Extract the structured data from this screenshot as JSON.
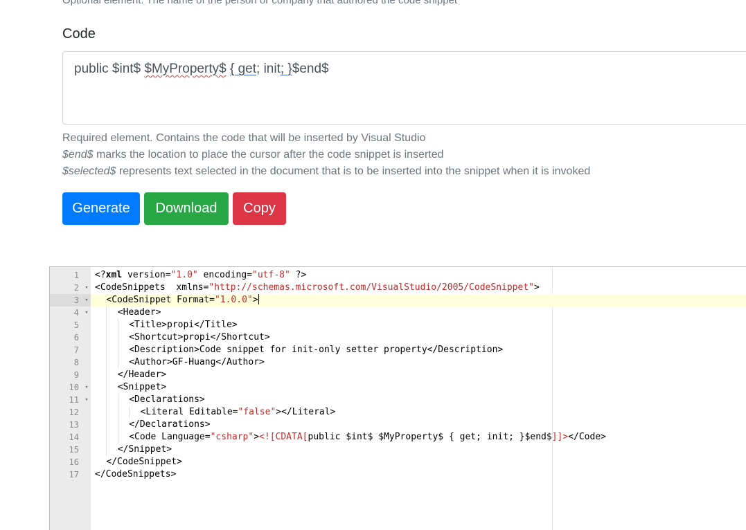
{
  "author_help": "Optional element. The name of the person or company that authored the code snippet",
  "code_field": {
    "label": "Code",
    "value_parts": [
      "public $int$ ",
      "$MyProperty$",
      " ",
      "{ get",
      "; init",
      ";",
      " }",
      "$end$"
    ],
    "help_lines": [
      {
        "em": "",
        "text": "Required element. Contains the code that will be inserted by Visual Studio"
      },
      {
        "em": "$end$",
        "text": " marks the location to place the cursor after the code snippet is inserted"
      },
      {
        "em": "$selected$",
        "text": " represents text selected in the document that is to be inserted into the snippet when it is invoked"
      }
    ]
  },
  "buttons": {
    "generate": "Generate",
    "download": "Download",
    "copy": "Copy"
  },
  "colors": {
    "generate": "#007bff",
    "download": "#28a745",
    "copy": "#dc3545",
    "string": "#c62828",
    "active_line": "#ffffdc"
  },
  "editor": {
    "active_line": 3,
    "lines": [
      {
        "n": "1",
        "fold": false,
        "indent": 0,
        "segments": [
          [
            "t",
            "<?"
          ],
          [
            "b",
            "xml"
          ],
          [
            "t",
            " version="
          ],
          [
            "s",
            "\"1.0\""
          ],
          [
            "t",
            " encoding="
          ],
          [
            "s",
            "\"utf-8\""
          ],
          [
            "t",
            " ?>"
          ]
        ]
      },
      {
        "n": "2",
        "fold": true,
        "indent": 0,
        "segments": [
          [
            "t",
            "<CodeSnippets  xmlns="
          ],
          [
            "s",
            "\"http://schemas.microsoft.com/VisualStudio/2005/CodeSnippet\""
          ],
          [
            "t",
            ">"
          ]
        ]
      },
      {
        "n": "3",
        "fold": true,
        "indent": 1,
        "segments": [
          [
            "t",
            "<CodeSnippet Format="
          ],
          [
            "s",
            "\"1.0.0\""
          ],
          [
            "t",
            ">"
          ]
        ],
        "cursor": true
      },
      {
        "n": "4",
        "fold": true,
        "indent": 2,
        "segments": [
          [
            "t",
            "<Header>"
          ]
        ]
      },
      {
        "n": "5",
        "fold": false,
        "indent": 3,
        "segments": [
          [
            "t",
            "<Title>propi</Title>"
          ]
        ]
      },
      {
        "n": "6",
        "fold": false,
        "indent": 3,
        "segments": [
          [
            "t",
            "<Shortcut>propi</Shortcut>"
          ]
        ]
      },
      {
        "n": "7",
        "fold": false,
        "indent": 3,
        "segments": [
          [
            "t",
            "<Description>Code snippet for init-only setter property</Description>"
          ]
        ]
      },
      {
        "n": "8",
        "fold": false,
        "indent": 3,
        "segments": [
          [
            "t",
            "<Author>GF-Huang</Author>"
          ]
        ]
      },
      {
        "n": "9",
        "fold": false,
        "indent": 2,
        "segments": [
          [
            "t",
            "</Header>"
          ]
        ]
      },
      {
        "n": "10",
        "fold": true,
        "indent": 2,
        "segments": [
          [
            "t",
            "<Snippet>"
          ]
        ]
      },
      {
        "n": "11",
        "fold": true,
        "indent": 3,
        "segments": [
          [
            "t",
            "<Declarations>"
          ]
        ]
      },
      {
        "n": "12",
        "fold": false,
        "indent": 4,
        "segments": [
          [
            "t",
            "<Literal Editable="
          ],
          [
            "s",
            "\"false\""
          ],
          [
            "t",
            "></Literal>"
          ]
        ]
      },
      {
        "n": "13",
        "fold": false,
        "indent": 3,
        "segments": [
          [
            "t",
            "</Declarations>"
          ]
        ]
      },
      {
        "n": "14",
        "fold": false,
        "indent": 3,
        "segments": [
          [
            "t",
            "<Code Language="
          ],
          [
            "s",
            "\"csharp\""
          ],
          [
            "t",
            ">"
          ],
          [
            "s",
            "<![CDATA["
          ],
          [
            "t",
            "public $int$ $MyProperty$ { get; init; }$end$"
          ],
          [
            "s",
            "]]>"
          ],
          [
            "t",
            "</Code>"
          ]
        ]
      },
      {
        "n": "15",
        "fold": false,
        "indent": 2,
        "segments": [
          [
            "t",
            "</Snippet>"
          ]
        ]
      },
      {
        "n": "16",
        "fold": false,
        "indent": 1,
        "segments": [
          [
            "t",
            "</CodeSnippet>"
          ]
        ]
      },
      {
        "n": "17",
        "fold": false,
        "indent": 0,
        "segments": [
          [
            "t",
            "</CodeSnippets>"
          ]
        ]
      }
    ]
  }
}
